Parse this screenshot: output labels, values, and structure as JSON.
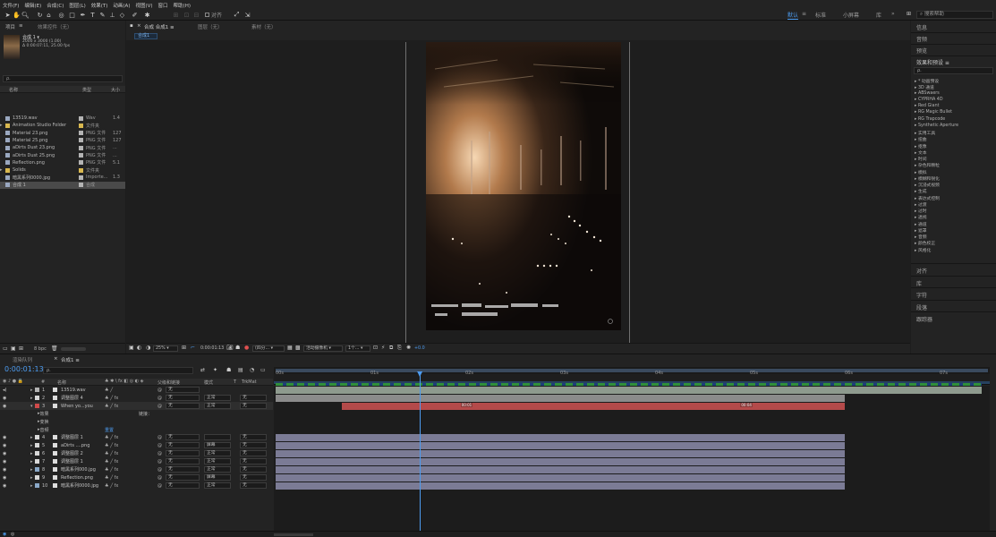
{
  "menu": [
    "文件(F)",
    "编辑(E)",
    "合成(C)",
    "图层(L)",
    "效果(T)",
    "动画(A)",
    "视图(V)",
    "窗口",
    "帮助(H)"
  ],
  "toolbar": {
    "snap_label": "对齐",
    "workspaces": [
      "默认",
      "标准",
      "小屏幕",
      "库"
    ],
    "active_workspace": "默认",
    "search_help_placeholder": "搜索帮助"
  },
  "project": {
    "tabs": [
      "项目",
      "效果控件（无）"
    ],
    "comp_name": "合成 1 ▾",
    "comp_info1": "2000 x 3000 (1.00)",
    "comp_info2": "Δ 0:00:07:11, 25.00 fps",
    "search_placeholder": "ρ.",
    "columns": [
      "名称",
      "类型",
      "大小"
    ],
    "items": [
      {
        "name": "13519.wav",
        "color": "#b4b4b4",
        "type": "Wav",
        "size": "1.4",
        "selected": false,
        "folder": false
      },
      {
        "name": "Animation Studio Folder",
        "color": "#d9b84f",
        "type": "文件夹",
        "size": "",
        "selected": false,
        "folder": true
      },
      {
        "name": "Material 23.png",
        "color": "#b4b4b4",
        "type": "PNG 文件",
        "size": "127",
        "selected": false,
        "folder": false
      },
      {
        "name": "Material 25.png",
        "color": "#b4b4b4",
        "type": "PNG 文件",
        "size": "127",
        "selected": false,
        "folder": false
      },
      {
        "name": "aDirts Dust 23.png",
        "color": "#b4b4b4",
        "type": "PNG 文件",
        "size": "...",
        "selected": false,
        "folder": false
      },
      {
        "name": "aDirts Dust 25.png",
        "color": "#b4b4b4",
        "type": "PNG 文件",
        "size": "...",
        "selected": false,
        "folder": false
      },
      {
        "name": "Reflection.png",
        "color": "#b4b4b4",
        "type": "PNG 文件",
        "size": "5.1",
        "selected": false,
        "folder": false
      },
      {
        "name": "Solids",
        "color": "#d9b84f",
        "type": "文件夹",
        "size": "",
        "selected": false,
        "folder": true
      },
      {
        "name": "暗黑系列0000.jpg",
        "color": "#b4b4b4",
        "type": "Importe...",
        "size": "1.3",
        "selected": false,
        "folder": false
      },
      {
        "name": "合成 1",
        "color": "#b4b4b4",
        "type": "合成",
        "size": "",
        "selected": true,
        "folder": false
      }
    ],
    "bpc": "8 bpc"
  },
  "viewer": {
    "tabs": [
      "合成 合成1 ≡",
      "图层（无）",
      "素材（无）"
    ],
    "comp_sub_tab": "合成1",
    "zoom": "25%",
    "timecode": "0:00:01:13",
    "resolution": "(四分...",
    "camera": "活动摄像机",
    "views": "1个...",
    "exposure": "+0.0"
  },
  "right_panel": {
    "top_items": [
      "信息",
      "音频",
      "预览"
    ],
    "effects_title": "效果和预设 ≡",
    "effects_search": "ρ.",
    "effects": [
      "* 动画预设",
      "3D 通道",
      "ABSwaers",
      "CYPRHA 4D",
      "Red Giant",
      "RG Magic Bullet",
      "RG Trapcode",
      "Synthetic Aperture",
      "实用工具",
      "扭曲",
      "抠像",
      "文本",
      "时间",
      "杂色和颗粒",
      "模拟",
      "模糊和锐化",
      "沉浸式视频",
      "生成",
      "表达式控制",
      "过渡",
      "过时",
      "透视",
      "通道",
      "遮罩",
      "音频",
      "颜色校正",
      "风格化"
    ],
    "bottom_items": [
      "对齐",
      "库",
      "字符",
      "段落",
      "跟踪器"
    ]
  },
  "timeline": {
    "tabs": [
      "渲染队列",
      "合成1 ≡"
    ],
    "timecode": "0:00:01:13",
    "search_placeholder": "ρ.",
    "header": [
      "#",
      "名称",
      "模式",
      "T",
      "TrkMat",
      "父级和链接"
    ],
    "ruler": [
      "00s",
      "01s",
      "02s",
      "03s",
      "04s",
      "05s",
      "06s",
      "07s"
    ],
    "sublabel_effects": "效果",
    "sublabel_transform": "变换",
    "sublabel_audio": "音频",
    "sublabel_reset": "重置",
    "sublabel_link": "链接：",
    "layers": [
      {
        "num": "1",
        "name": "13519.wav",
        "label": "#b4b4b4",
        "mode": "",
        "parent": "无",
        "start": 0,
        "end": 7.44,
        "bar": "#8e9a8e",
        "audio": true
      },
      {
        "num": "2",
        "name": "调整图层 4",
        "label": "#d8d8d8",
        "mode": "正常",
        "parent": "无",
        "start": 0,
        "end": 6,
        "bar": "#8b8b8b",
        "audio": false
      },
      {
        "num": "3",
        "name": "When yo...you",
        "label": "#d04a4a",
        "mode": "正常",
        "parent": "无",
        "start": 0.7,
        "end": 6,
        "bar": "#b44a4a",
        "audio": false
      },
      {
        "num": "4",
        "name": "调整图层 1",
        "label": "#d8d8d8",
        "mode": "",
        "parent": "无",
        "start": 0,
        "end": 6,
        "bar": "#7b7b95",
        "audio": false
      },
      {
        "num": "5",
        "name": "aDirts ....png",
        "label": "#d8d8d8",
        "mode": "屏幕",
        "parent": "无",
        "start": 0,
        "end": 6,
        "bar": "#7b7b95",
        "audio": false
      },
      {
        "num": "6",
        "name": "调整图层 2",
        "label": "#d8d8d8",
        "mode": "正常",
        "parent": "无",
        "start": 0,
        "end": 6,
        "bar": "#7b7b95",
        "audio": false
      },
      {
        "num": "7",
        "name": "调整图层 1",
        "label": "#d8d8d8",
        "mode": "正常",
        "parent": "无",
        "start": 0,
        "end": 6,
        "bar": "#7b7b95",
        "audio": false
      },
      {
        "num": "8",
        "name": "暗黑系列000.jpg",
        "label": "#8aa8c8",
        "mode": "正常",
        "parent": "无",
        "start": 0,
        "end": 6,
        "bar": "#7b7b95",
        "audio": false
      },
      {
        "num": "9",
        "name": "Reflection.png",
        "label": "#d8d8d8",
        "mode": "屏幕",
        "parent": "无",
        "start": 0,
        "end": 6,
        "bar": "#7b7b95",
        "audio": false
      },
      {
        "num": "10",
        "name": "暗黑系列0000.jpg",
        "label": "#8aa8c8",
        "mode": "正常",
        "parent": "无",
        "start": 0,
        "end": 6,
        "bar": "#7b7b95",
        "audio": false
      }
    ],
    "playhead_seconds": 1.52,
    "keyframe_labels": [
      "00:01",
      "00:04"
    ],
    "duration_seconds": 7.44
  }
}
